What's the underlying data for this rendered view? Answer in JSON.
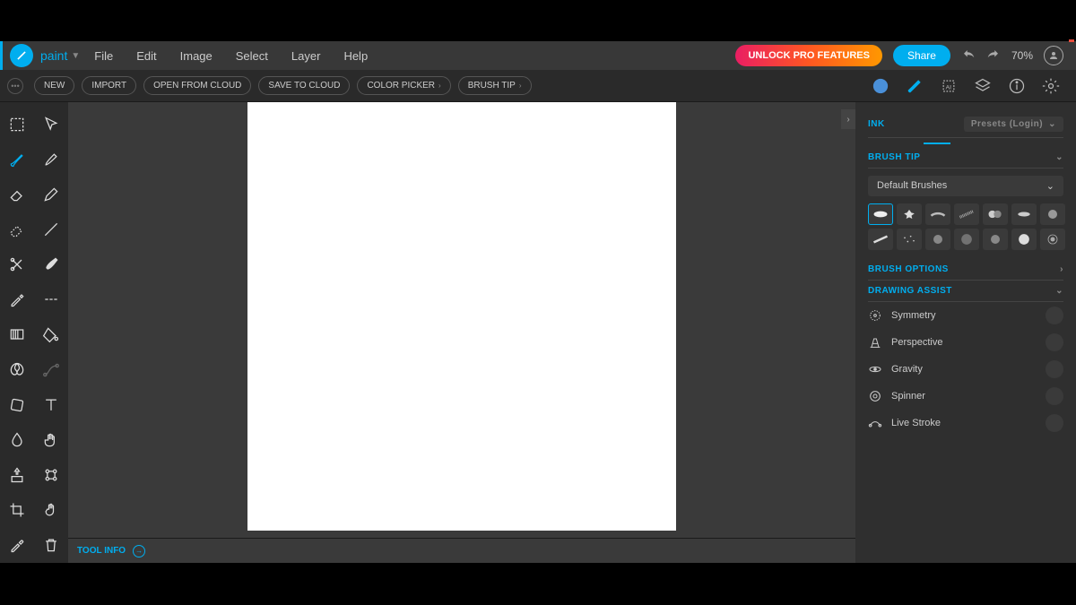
{
  "app_name": "paint",
  "menu": [
    "File",
    "Edit",
    "Image",
    "Select",
    "Layer",
    "Help"
  ],
  "unlock": "UNLOCK PRO FEATURES",
  "share": "Share",
  "zoom": "70%",
  "pills": {
    "new": "NEW",
    "import": "IMPORT",
    "open": "OPEN FROM CLOUD",
    "save": "SAVE TO CLOUD",
    "color": "COLOR PICKER",
    "brush": "BRUSH TIP"
  },
  "tool_info": "TOOL INFO",
  "panel": {
    "ink": "INK",
    "presets": "Presets (Login)",
    "brush_tip": "BRUSH TIP",
    "default_brushes": "Default Brushes",
    "brush_options": "BRUSH OPTIONS",
    "drawing_assist": "DRAWING ASSIST",
    "assist": [
      "Symmetry",
      "Perspective",
      "Gravity",
      "Spinner",
      "Live Stroke"
    ]
  }
}
